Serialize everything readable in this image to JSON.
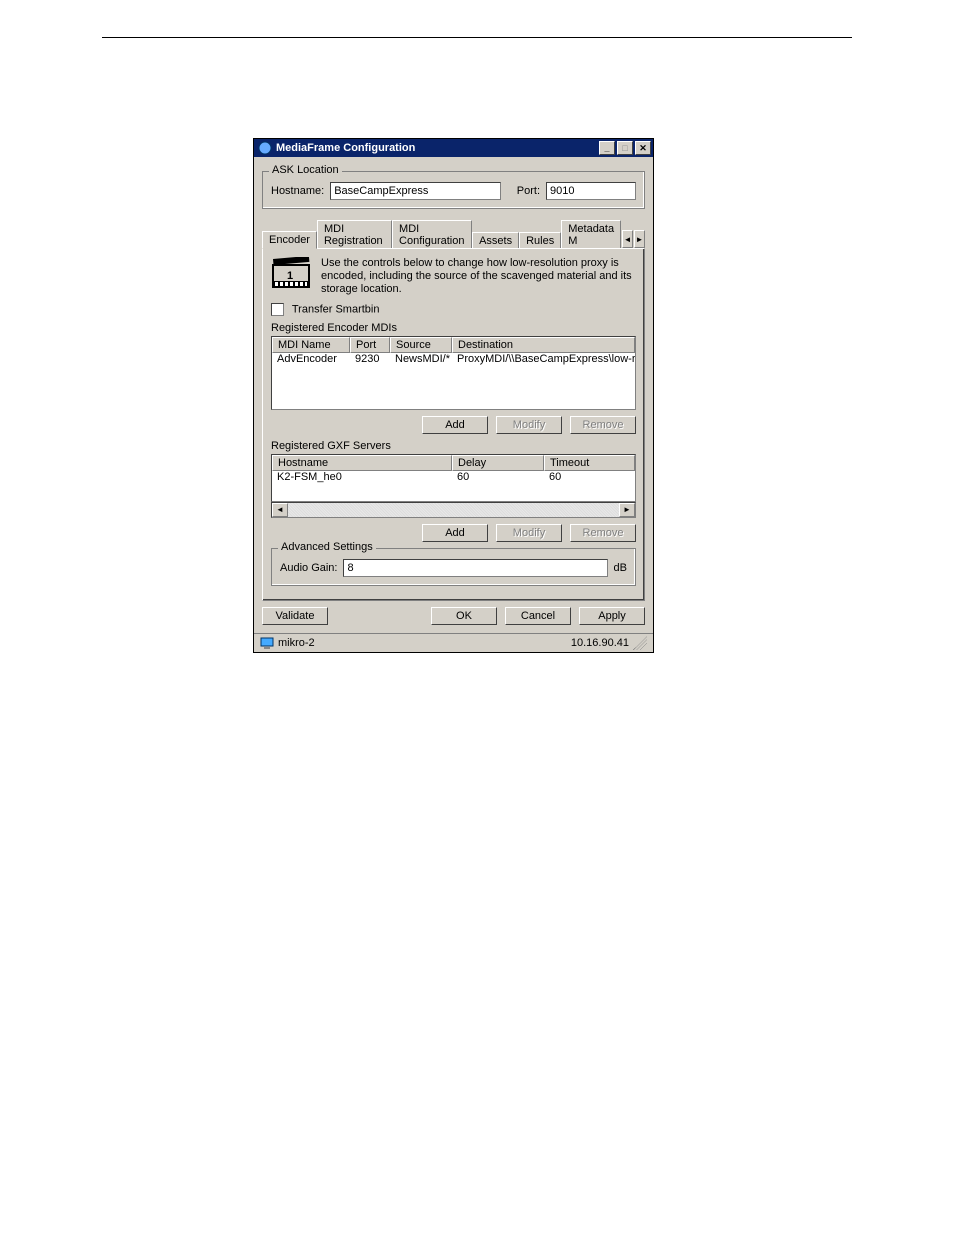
{
  "window": {
    "title": "MediaFrame Configuration"
  },
  "ask_location": {
    "legend": "ASK Location",
    "hostname_label": "Hostname:",
    "hostname_value": "BaseCampExpress",
    "port_label": "Port:",
    "port_value": "9010"
  },
  "tabs": {
    "encoder": "Encoder",
    "mdi_registration": "MDI Registration",
    "mdi_configuration": "MDI Configuration",
    "assets": "Assets",
    "rules": "Rules",
    "metadata": "Metadata M"
  },
  "encoder": {
    "description": "Use the controls below to change how low-resolution proxy is encoded, including the source of the scavenged material and its storage location.",
    "transfer_smartbin_label": "Transfer Smartbin",
    "registered_encoder_mdis_label": "Registered Encoder MDIs",
    "mdi_table": {
      "headers": {
        "name": "MDI Name",
        "port": "Port",
        "source": "Source",
        "destination": "Destination"
      },
      "rows": [
        {
          "name": "AdvEncoder",
          "port": "9230",
          "source": "NewsMDI/*",
          "destination": "ProxyMDI/\\\\BaseCampExpress\\low-res"
        }
      ]
    },
    "registered_gxf_label": "Registered GXF Servers",
    "gxf_table": {
      "headers": {
        "hostname": "Hostname",
        "delay": "Delay",
        "timeout": "Timeout"
      },
      "rows": [
        {
          "hostname": "K2-FSM_he0",
          "delay": "60",
          "timeout": "60"
        }
      ]
    },
    "buttons": {
      "add": "Add",
      "modify": "Modify",
      "remove": "Remove"
    },
    "advanced": {
      "legend": "Advanced Settings",
      "audio_gain_label": "Audio Gain:",
      "audio_gain_value": "8",
      "audio_gain_unit": "dB"
    }
  },
  "bottom": {
    "validate": "Validate",
    "ok": "OK",
    "cancel": "Cancel",
    "apply": "Apply"
  },
  "status": {
    "host": "mikro-2",
    "ip": "10.16.90.41"
  }
}
